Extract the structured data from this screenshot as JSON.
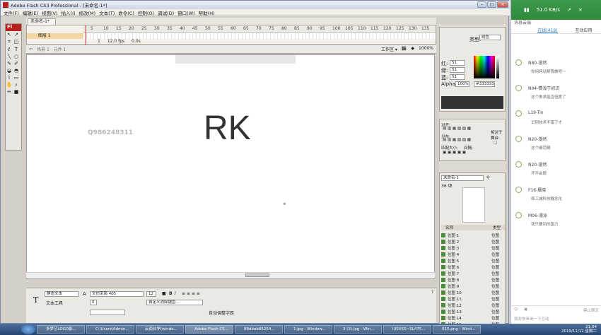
{
  "window": {
    "title": "Adobe Flash CS3 Professional - [未命名-1*]"
  },
  "menu": [
    "文件(F)",
    "编辑(E)",
    "视图(V)",
    "插入(I)",
    "修改(M)",
    "文本(T)",
    "命令(C)",
    "控制(O)",
    "调试(D)",
    "窗口(W)",
    "帮助(H)"
  ],
  "document": {
    "tab_label": "未命名-1*",
    "scene": "场景 1",
    "element": "元件 1",
    "workspace": "工作区 ▾",
    "zoom": "1000%"
  },
  "timeline": {
    "layer_name": "图层 1",
    "ruler": [
      "5",
      "10",
      "15",
      "20",
      "25",
      "30",
      "35",
      "40",
      "45",
      "50",
      "55",
      "60",
      "65",
      "70",
      "75",
      "80",
      "85",
      "90",
      "95",
      "100",
      "105",
      "110",
      "115",
      "120",
      "125",
      "130",
      "135"
    ],
    "frame": "1",
    "fps": "12.0 fps",
    "time": "0.0s"
  },
  "stage": {
    "watermark": "Q986248311",
    "main_text": "RK"
  },
  "properties": {
    "text_type": "静态文本",
    "text_tool_label": "文本工具",
    "font": "文仿宋简 405",
    "size": "12",
    "spacing": "0",
    "auto_kern": "自动调整字距",
    "anti_alias": "自定义消除锯齿..."
  },
  "color_panel": {
    "type_label": "类型:",
    "type_value": "纯色",
    "r": "51",
    "g": "51",
    "b": "51",
    "alpha": "100%",
    "hex": "#333333"
  },
  "align_panel": {
    "title": "对齐:",
    "distribute": "分布:",
    "match_size": "匹配大小:",
    "spacing": "间隔:",
    "relative": "相对于舞台:"
  },
  "library": {
    "doc": "未命名-1",
    "count": "36 项",
    "col_name": "名称",
    "col_type": "类型",
    "items": [
      {
        "name": "位图 1",
        "type": "位图"
      },
      {
        "name": "位图 2",
        "type": "位图"
      },
      {
        "name": "位图 3",
        "type": "位图"
      },
      {
        "name": "位图 4",
        "type": "位图"
      },
      {
        "name": "位图 5",
        "type": "位图"
      },
      {
        "name": "位图 6",
        "type": "位图"
      },
      {
        "name": "位图 7",
        "type": "位图"
      },
      {
        "name": "位图 8",
        "type": "位图"
      },
      {
        "name": "位图 9",
        "type": "位图"
      },
      {
        "name": "位图 10",
        "type": "位图"
      },
      {
        "name": "位图 11",
        "type": "位图"
      },
      {
        "name": "位图 12",
        "type": "位图"
      },
      {
        "name": "位图 13",
        "type": "位图"
      },
      {
        "name": "位图 14",
        "type": "位图"
      },
      {
        "name": "位图 15",
        "type": "位图"
      }
    ]
  },
  "chat": {
    "speed": "51.0 KB/s",
    "subtitle": "消息云端",
    "tabs": [
      "",
      "在线(419)",
      "互动应用"
    ],
    "messages": [
      {
        "name": "N80-漫然",
        "text": "你用网站帮我做吧一"
      },
      {
        "name": "N04-情浅于初识",
        "text": "这个角求能否但愿了"
      },
      {
        "name": "L19-Tin",
        "text": "识别技术不错了才"
      },
      {
        "name": "N20-漫然",
        "text": "这个细范畴"
      },
      {
        "name": "N20-漫然",
        "text": "开不会题"
      },
      {
        "name": "F16-晨晓",
        "text": "修工减科技概念化"
      },
      {
        "name": "M06-漫泳",
        "text": "我只要到的国力"
      }
    ],
    "input_placeholder": "我对你来说一下互动",
    "forbid": "禁止聊天"
  },
  "taskbar": {
    "items": [
      "多梦艺LOGO影...",
      "C:\\Users\\Admin...",
      "云南台学(windo...",
      "Adobe Flash CS...",
      "88dbeb85254...",
      "1.jpg - Window...",
      "3 (3).jpg - Win...",
      "l(ISXKS~SL475...",
      "015.png - Wind..."
    ],
    "time": "21:04",
    "date": "2019/11/12 星期二"
  }
}
